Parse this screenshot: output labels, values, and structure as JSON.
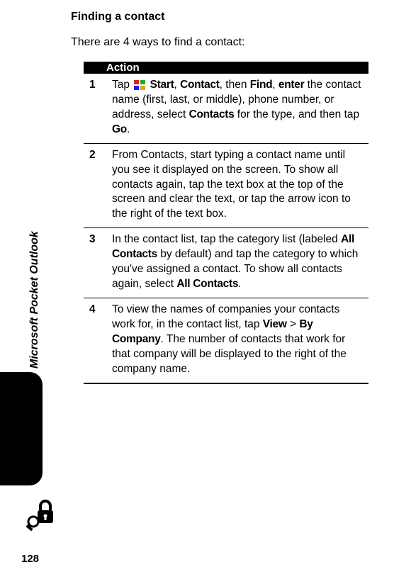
{
  "heading": "Finding a contact",
  "intro": "There are 4 ways to find a contact:",
  "tableHeader": "Action",
  "rows": [
    {
      "num": "1",
      "pre": "Tap ",
      "b1": "Start",
      "sep1": ", ",
      "b2": "Contact",
      "sep2": ", then ",
      "b3": "Find",
      "sep3": ", ",
      "b4": "enter",
      "mid": " the contact name (first, last, or middle), phone number, or address, select ",
      "b5": "Contacts",
      "mid2": " for the type, and then tap ",
      "b6": "Go",
      "end": "."
    },
    {
      "num": "2",
      "text": "From Contacts, start typing a contact name until you see it displayed on the screen. To show all contacts again, tap the text box at the top of the screen and clear the text, or tap the arrow icon to the right of the text box."
    },
    {
      "num": "3",
      "pre": "In the contact list, tap the category list (labeled ",
      "b1": "All Contacts",
      "mid": " by default) and tap the category to which you've assigned a contact. To show all contacts again, select ",
      "b2": "All Contacts",
      "end": "."
    },
    {
      "num": "4",
      "pre": "To view the names of companies your contacts work for, in the contact list, tap ",
      "b1": "View",
      "sep1": " > ",
      "b2": "By Company",
      "end": ". The number of contacts that work for that company will be displayed to the right of the company name."
    }
  ],
  "sidebar": "Microsoft Pocket Outlook",
  "pageNum": "128"
}
